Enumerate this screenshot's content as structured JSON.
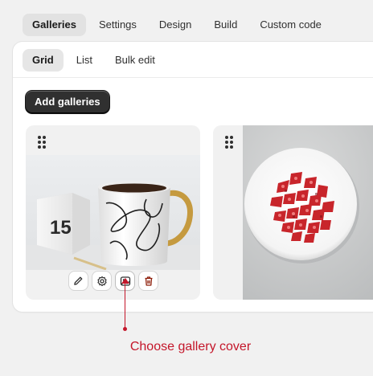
{
  "top_tabs": [
    {
      "label": "Galleries",
      "active": true
    },
    {
      "label": "Settings",
      "active": false
    },
    {
      "label": "Design",
      "active": false
    },
    {
      "label": "Build",
      "active": false
    },
    {
      "label": "Custom code",
      "active": false
    }
  ],
  "sub_tabs": [
    {
      "label": "Grid",
      "active": true
    },
    {
      "label": "List",
      "active": false
    },
    {
      "label": "Bulk edit",
      "active": false
    }
  ],
  "add_button": {
    "label": "Add galleries"
  },
  "cards": [
    {
      "actions": [
        "pencil-icon",
        "gear-icon",
        "image-cover-icon",
        "trash-icon"
      ]
    },
    {}
  ],
  "mug_calendar": {
    "number": "15"
  },
  "annotation": {
    "text": "Choose gallery cover",
    "color": "#c4162a"
  },
  "colors": {
    "accent_dark": "#303030",
    "danger": "#c4162a",
    "background": "#f1f1f1"
  }
}
